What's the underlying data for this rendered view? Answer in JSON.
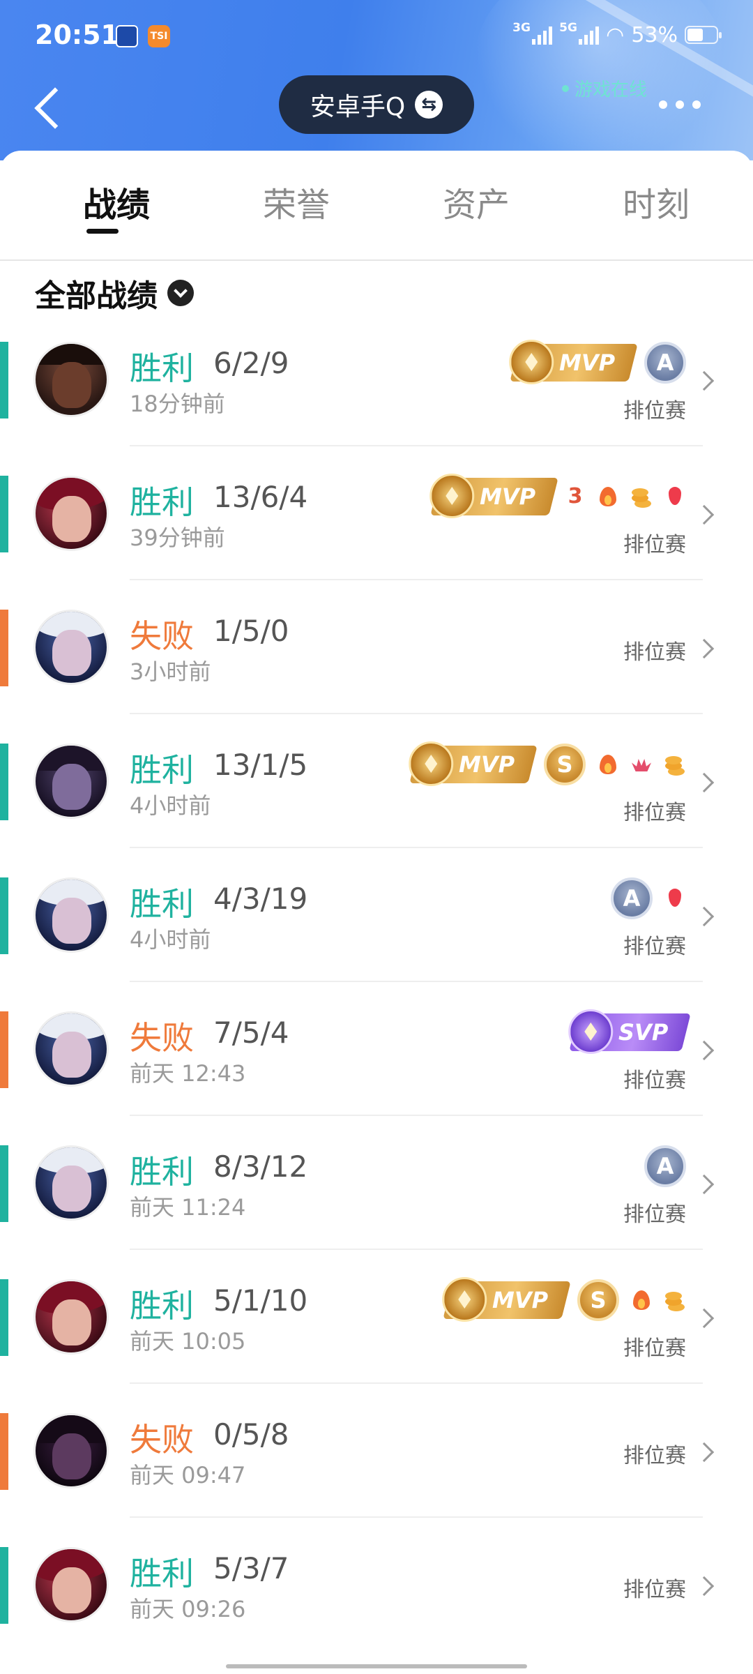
{
  "status_bar": {
    "time": "20:51",
    "app1_icon": "bank-app-icon",
    "app2_label": "TSI",
    "net1": "3G",
    "net2": "5G",
    "battery": "53%"
  },
  "header": {
    "account": "安卓手Q",
    "online_status": "游戏在线",
    "back_icon": "back-arrow-icon",
    "more_icon": "more-dots-icon",
    "swap_icon_glyph": "⇆"
  },
  "tabs": [
    {
      "label": "战绩",
      "active": true
    },
    {
      "label": "荣誉",
      "active": false
    },
    {
      "label": "资产",
      "active": false
    },
    {
      "label": "时刻",
      "active": false
    }
  ],
  "filter": {
    "label": "全部战绩"
  },
  "colors": {
    "win": "#1fb29f",
    "loss": "#ef7a3b",
    "header": "#4a86f0"
  },
  "records": [
    {
      "result": "胜利",
      "kda": "6/2/9",
      "time": "18分钟前",
      "mode": "排位赛",
      "type": "win",
      "hero": "lucian",
      "badges": [
        "mvp",
        "grade-a"
      ]
    },
    {
      "result": "胜利",
      "kda": "13/6/4",
      "time": "39分钟前",
      "mode": "排位赛",
      "type": "win",
      "hero": "fiora",
      "badges": [
        "mvp",
        "triple-kill",
        "fire",
        "coins",
        "blood"
      ]
    },
    {
      "result": "失败",
      "kda": "1/5/0",
      "time": "3小时前",
      "mode": "排位赛",
      "type": "loss",
      "hero": "ashe",
      "badges": []
    },
    {
      "result": "胜利",
      "kda": "13/1/5",
      "time": "4小时前",
      "mode": "排位赛",
      "type": "win",
      "hero": "dark",
      "badges": [
        "mvp",
        "grade-s",
        "fire",
        "lotus",
        "coins"
      ]
    },
    {
      "result": "胜利",
      "kda": "4/3/19",
      "time": "4小时前",
      "mode": "排位赛",
      "type": "win",
      "hero": "ashe",
      "badges": [
        "grade-a",
        "blood"
      ]
    },
    {
      "result": "失败",
      "kda": "7/5/4",
      "time": "前天 12:43",
      "mode": "排位赛",
      "type": "loss",
      "hero": "ashe",
      "badges": [
        "svp"
      ]
    },
    {
      "result": "胜利",
      "kda": "8/3/12",
      "time": "前天 11:24",
      "mode": "排位赛",
      "type": "win",
      "hero": "ashe",
      "badges": [
        "grade-a"
      ]
    },
    {
      "result": "胜利",
      "kda": "5/1/10",
      "time": "前天 10:05",
      "mode": "排位赛",
      "type": "win",
      "hero": "fiora",
      "badges": [
        "mvp",
        "grade-s",
        "fire",
        "coins"
      ]
    },
    {
      "result": "失败",
      "kda": "0/5/8",
      "time": "前天 09:47",
      "mode": "排位赛",
      "type": "loss",
      "hero": "morgana",
      "badges": []
    },
    {
      "result": "胜利",
      "kda": "5/3/7",
      "time": "前天 09:26",
      "mode": "排位赛",
      "type": "win",
      "hero": "fiora",
      "badges": []
    }
  ],
  "badge_text": {
    "mvp": "MVP",
    "svp": "SVP",
    "grade-a": "A",
    "grade-s": "S",
    "triple-kill": "3"
  }
}
